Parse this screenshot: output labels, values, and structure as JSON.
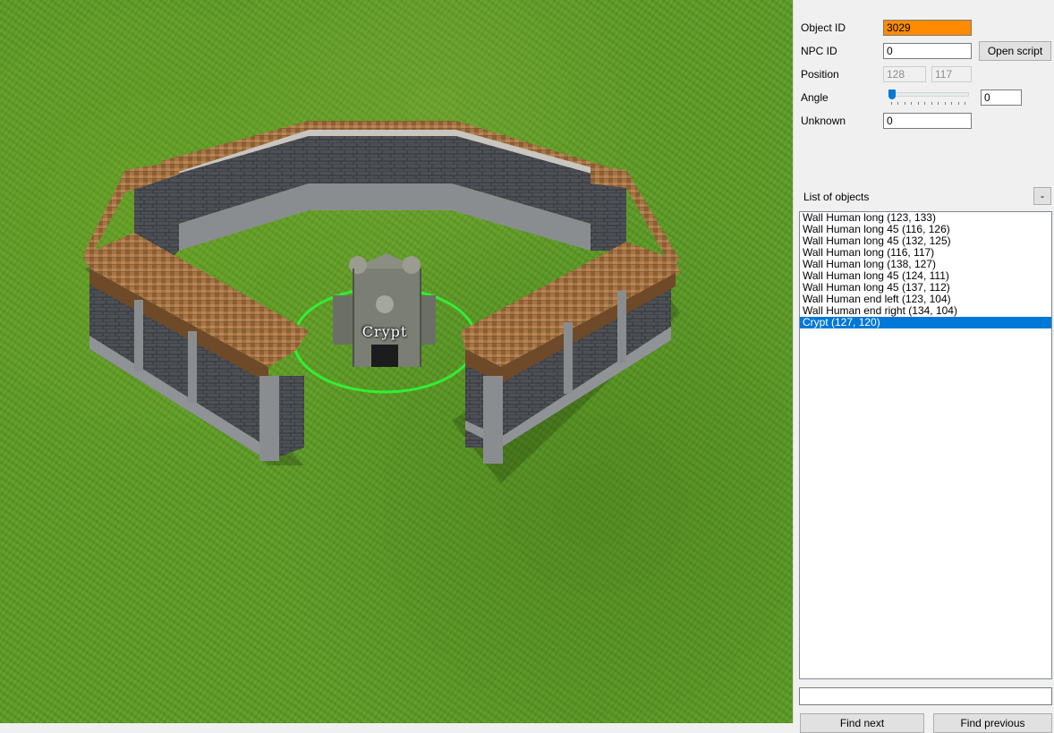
{
  "viewport": {
    "selected_object_label": "Crypt"
  },
  "panel": {
    "object_id": {
      "label": "Object ID",
      "value": "3029"
    },
    "npc_id": {
      "label": "NPC ID",
      "value": "0"
    },
    "open_script_label": "Open script",
    "position": {
      "label": "Position",
      "x": "128",
      "y": "117"
    },
    "angle": {
      "label": "Angle",
      "value": "0",
      "slider_value": 0
    },
    "unknown": {
      "label": "Unknown",
      "value": "0"
    },
    "list_title": "List of objects",
    "collapse_label": "-",
    "objects": [
      {
        "label": "Wall Human long (123, 133)",
        "selected": false
      },
      {
        "label": "Wall Human long 45 (116, 126)",
        "selected": false
      },
      {
        "label": "Wall Human long 45 (132, 125)",
        "selected": false
      },
      {
        "label": "Wall Human long (116, 117)",
        "selected": false
      },
      {
        "label": "Wall Human long (138, 127)",
        "selected": false
      },
      {
        "label": "Wall Human long 45 (124, 111)",
        "selected": false
      },
      {
        "label": "Wall Human long 45 (137, 112)",
        "selected": false
      },
      {
        "label": "Wall Human end left (123, 104)",
        "selected": false
      },
      {
        "label": "Wall Human end right (134, 104)",
        "selected": false
      },
      {
        "label": "Crypt (127, 120)",
        "selected": true
      }
    ],
    "search_value": "",
    "find_next_label": "Find next",
    "find_previous_label": "Find previous"
  },
  "colors": {
    "highlight_field": "#ff8c00",
    "selection": "#0078d7",
    "selection_ring": "#33ee33"
  }
}
